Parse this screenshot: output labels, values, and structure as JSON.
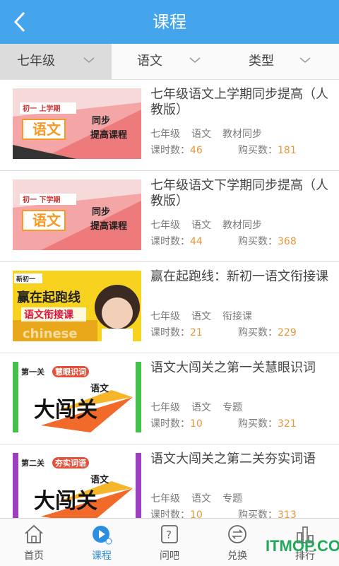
{
  "header": {
    "title": "课程",
    "back_icon": "chevron-left-icon"
  },
  "filters": [
    {
      "label": "七年级",
      "active": true
    },
    {
      "label": "语文",
      "active": false
    },
    {
      "label": "类型",
      "active": false
    }
  ],
  "courses": [
    {
      "title": "七年级语文上学期同步提高（人教版）",
      "grade": "七年级",
      "subject": "语文",
      "type": "教材同步",
      "lessons_label": "课时数：",
      "lessons": "46",
      "buyers_label": "购买数：",
      "buyers": "181",
      "thumb": {
        "badge": "初一 上学期",
        "subject": "语文",
        "line1": "同步",
        "line2": "提高课程"
      }
    },
    {
      "title": "七年级语文下学期同步提高（人教版）",
      "grade": "七年级",
      "subject": "语文",
      "type": "教材同步",
      "lessons_label": "课时数：",
      "lessons": "44",
      "buyers_label": "购买数：",
      "buyers": "368",
      "thumb": {
        "badge": "初一 下学期",
        "subject": "语文",
        "line1": "同步",
        "line2": "提高课程"
      }
    },
    {
      "title": "赢在起跑线：新初一语文衔接课",
      "grade": "七年级",
      "subject": "语文",
      "type": "衔接课",
      "lessons_label": "课时数：",
      "lessons": "21",
      "buyers_label": "购买数：",
      "buyers": "229",
      "thumb": {
        "badge": "新初一",
        "headline": "赢在起跑线",
        "sub": "语文衔接课",
        "eng": "chinese"
      }
    },
    {
      "title": "语文大闯关之第一关慧眼识词",
      "grade": "七年级",
      "subject": "语文",
      "type": "专题",
      "lessons_label": "课时数：",
      "lessons": "10",
      "buyers_label": "购买数：",
      "buyers": "321",
      "thumb": {
        "level": "第一关",
        "tag": "慧眼识词",
        "small": "语文",
        "big": "大闯关"
      }
    },
    {
      "title": "语文大闯关之第二关夯实词语",
      "grade": "七年级",
      "subject": "语文",
      "type": "专题",
      "lessons_label": "课时数：",
      "lessons": "10",
      "buyers_label": "购买数：",
      "buyers": "313",
      "thumb": {
        "level": "第二关",
        "tag": "夯实词语",
        "small": "语文",
        "big": "大闯关"
      }
    }
  ],
  "tabbar": [
    {
      "label": "首页",
      "icon": "home-icon",
      "active": false
    },
    {
      "label": "课程",
      "icon": "play-icon",
      "active": true
    },
    {
      "label": "问吧",
      "icon": "question-icon",
      "active": false
    },
    {
      "label": "兑换",
      "icon": "exchange-icon",
      "active": false
    },
    {
      "label": "排行",
      "icon": "ranking-icon",
      "active": false
    }
  ],
  "watermark": "ITMOP.COM",
  "colors": {
    "header": "#44a4ec",
    "accent_number": "#e8963a",
    "active_tab": "#2a8fe0"
  }
}
